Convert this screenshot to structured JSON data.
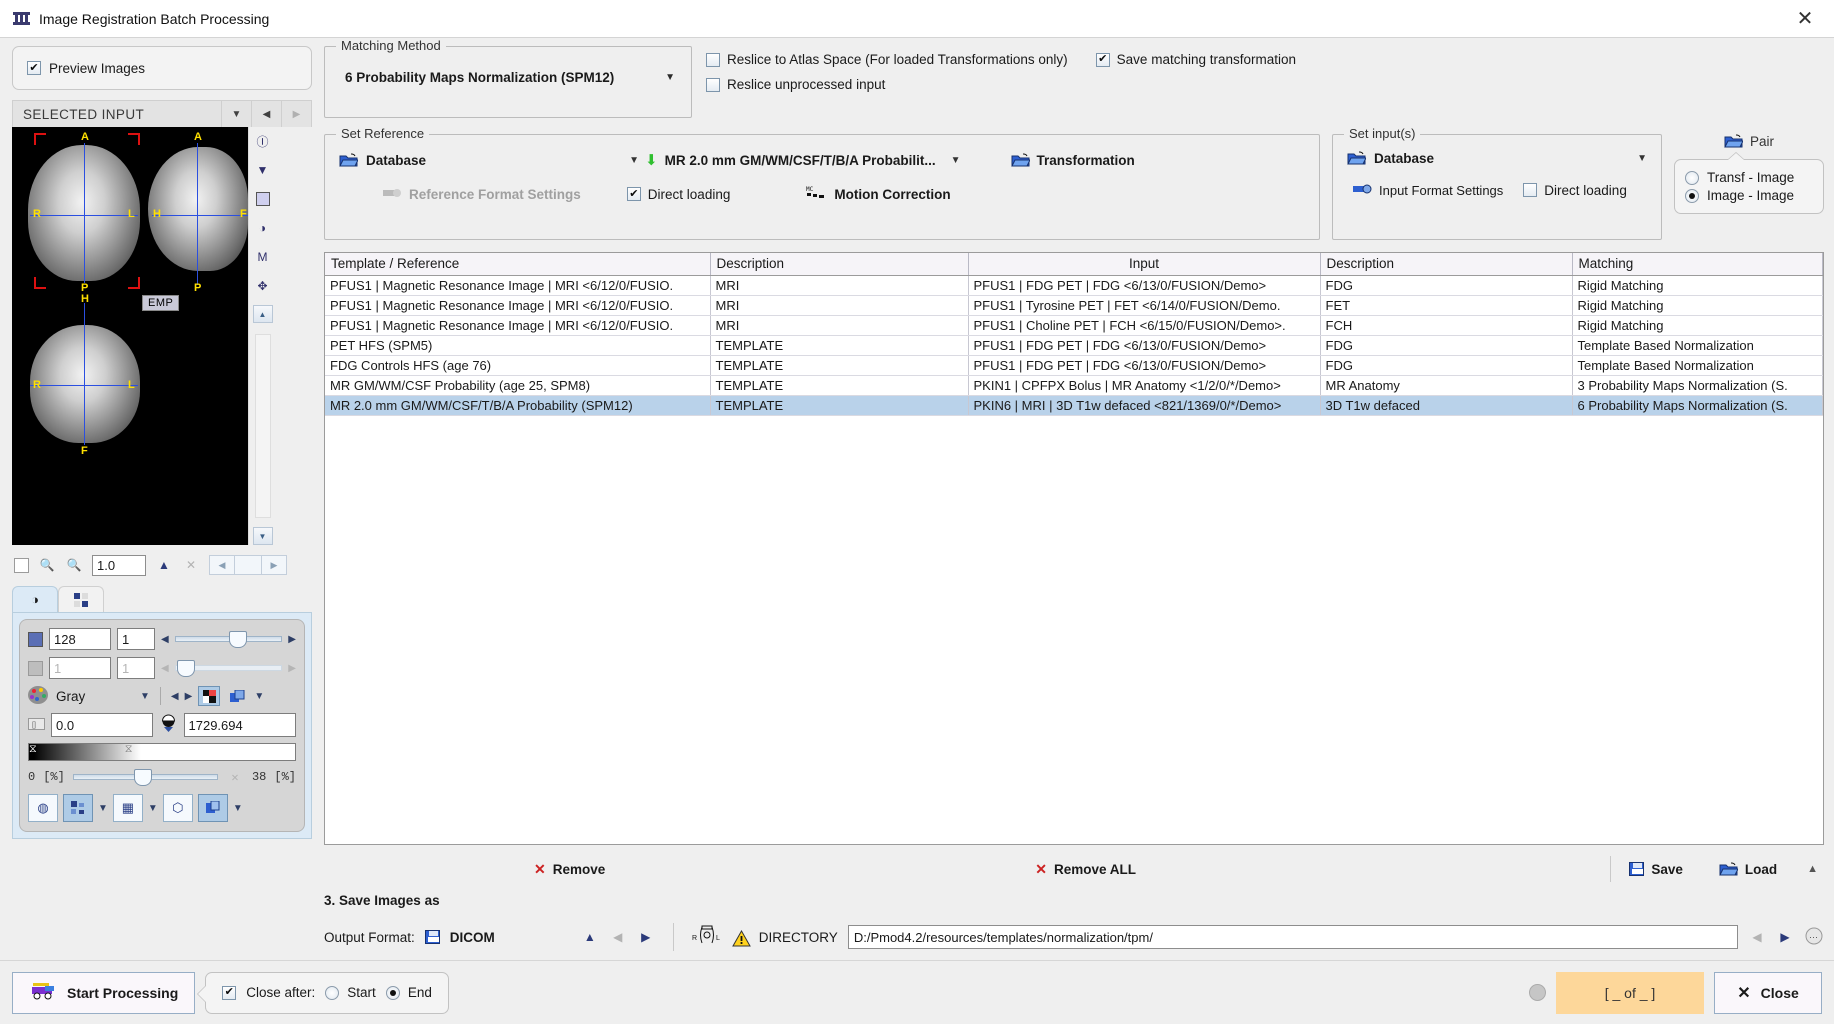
{
  "window": {
    "title": "Image Registration Batch Processing",
    "icon": "app-icon",
    "close_glyph": "✕"
  },
  "left": {
    "preview_checkbox": {
      "label": "Preview Images",
      "checked": true
    },
    "selected_input": {
      "title": "SELECTED INPUT",
      "caret": "▼",
      "prev": "◀",
      "next": "▶"
    },
    "viewer": {
      "labels": {
        "anterior": "A",
        "posterior": "P",
        "right": "R",
        "left": "L",
        "head": "H",
        "feet": "F"
      },
      "overlay_tag": "EMP"
    },
    "zoom_row": {
      "value": "1.0",
      "zoom_in_icon": "zoom-in-icon",
      "zoom_out_icon": "zoom-out-icon"
    },
    "tabs": [
      {
        "name": "contrast-tab",
        "icon": "contrast-icon",
        "active": true
      },
      {
        "name": "layout-tab",
        "icon": "grid-icon",
        "active": false
      }
    ],
    "controls": {
      "row1": {
        "value": "128",
        "value2": "1",
        "enabled": true
      },
      "row2": {
        "value": "1",
        "value2": "1",
        "enabled": false
      },
      "colortable": "Gray",
      "min_value": "0.0",
      "max_value": "1729.694",
      "pct_min": "0",
      "pct_min_unit": "[%]",
      "pct_max": "38",
      "pct_max_unit": "[%]"
    }
  },
  "matching_method": {
    "group_label": "Matching Method",
    "selected": "6 Probability Maps Normalization (SPM12)",
    "caret": "▼"
  },
  "top_options": [
    {
      "label": "Reslice to Atlas Space (For loaded Transformations only)",
      "checked": false
    },
    {
      "label": "Save matching transformation",
      "checked": true
    },
    {
      "label": "Reslice unprocessed input",
      "checked": false
    }
  ],
  "set_reference": {
    "group_label": "Set Reference",
    "source": "Database",
    "source_caret": "▼",
    "target": "MR 2.0 mm GM/WM/CSF/T/B/A Probabilit...",
    "target_caret": "▼",
    "transformation_button": "Transformation",
    "motion_correction_button": "Motion Correction",
    "format_settings": "Reference Format Settings",
    "direct_loading": {
      "label": "Direct loading",
      "checked": true
    }
  },
  "set_inputs": {
    "group_label": "Set input(s)",
    "source": "Database",
    "source_caret": "▼",
    "format_settings": "Input Format Settings",
    "direct_loading": {
      "label": "Direct loading",
      "checked": false
    }
  },
  "pair": {
    "label": "Pair",
    "options": [
      {
        "label": "Transf - Image",
        "selected": false
      },
      {
        "label": "Image - Image",
        "selected": true
      }
    ]
  },
  "table": {
    "columns": [
      "Template / Reference",
      "Description",
      "Input",
      "Description",
      "Matching"
    ],
    "rows": [
      {
        "reference": "PFUS1 | Magnetic Resonance Image | MRI <6/12/0/FUSIO.",
        "ref_desc": "MRI",
        "input": "PFUS1 | FDG PET | FDG <6/13/0/FUSION/Demo>",
        "input_desc": "FDG",
        "matching": "Rigid Matching",
        "selected": false
      },
      {
        "reference": "PFUS1 | Magnetic Resonance Image | MRI <6/12/0/FUSIO.",
        "ref_desc": "MRI",
        "input": "PFUS1 | Tyrosine PET | FET <6/14/0/FUSION/Demo.",
        "input_desc": "FET",
        "matching": "Rigid Matching",
        "selected": false
      },
      {
        "reference": "PFUS1 | Magnetic Resonance Image | MRI <6/12/0/FUSIO.",
        "ref_desc": "MRI",
        "input": "PFUS1 | Choline PET | FCH <6/15/0/FUSION/Demo>.",
        "input_desc": "FCH",
        "matching": "Rigid Matching",
        "selected": false
      },
      {
        "reference": "PET HFS (SPM5)",
        "ref_desc": "TEMPLATE",
        "input": "PFUS1 | FDG PET | FDG <6/13/0/FUSION/Demo>",
        "input_desc": "FDG",
        "matching": "Template Based Normalization",
        "selected": false
      },
      {
        "reference": "FDG Controls HFS (age 76)",
        "ref_desc": "TEMPLATE",
        "input": "PFUS1 | FDG PET | FDG <6/13/0/FUSION/Demo>",
        "input_desc": "FDG",
        "matching": "Template Based Normalization",
        "selected": false
      },
      {
        "reference": "MR GM/WM/CSF Probability (age 25, SPM8)",
        "ref_desc": "TEMPLATE",
        "input": "PKIN1 | CPFPX Bolus | MR Anatomy <1/2/0/*/Demo>",
        "input_desc": "MR Anatomy",
        "matching": "3 Probability Maps Normalization (S.",
        "selected": false
      },
      {
        "reference": "MR 2.0 mm GM/WM/CSF/T/B/A Probability (SPM12)",
        "ref_desc": "TEMPLATE",
        "input": "PKIN6 | MRI | 3D T1w defaced <821/1369/0/*/Demo>",
        "input_desc": "3D T1w defaced",
        "matching": "6 Probability Maps Normalization (S.",
        "selected": true
      }
    ]
  },
  "actions": {
    "remove": "Remove",
    "remove_all": "Remove ALL",
    "save": "Save",
    "load": "Load",
    "collapse_caret": "▲"
  },
  "save_section": {
    "heading": "3. Save Images as",
    "output_format_label": "Output Format:",
    "output_format_value": "DICOM",
    "directory_label": "DIRECTORY",
    "directory_path": "D:/Pmod4.2/resources/templates/normalization/tpm/",
    "orientation_icon": "orientation-icon",
    "warning_icon": "warning-icon"
  },
  "footer": {
    "start_processing": "Start Processing",
    "close_after_label": "Close after:",
    "close_after_checked": true,
    "close_after_options": [
      {
        "label": "Start",
        "selected": false
      },
      {
        "label": "End",
        "selected": true
      }
    ],
    "progress_text": "[ _ of _ ]",
    "close": "Close"
  },
  "colors": {
    "selection_blue": "#b9d2ea",
    "progress_orange": "#fdd79a",
    "accent_blue": "#2d5fd0",
    "warning_red": "#cc2222"
  }
}
